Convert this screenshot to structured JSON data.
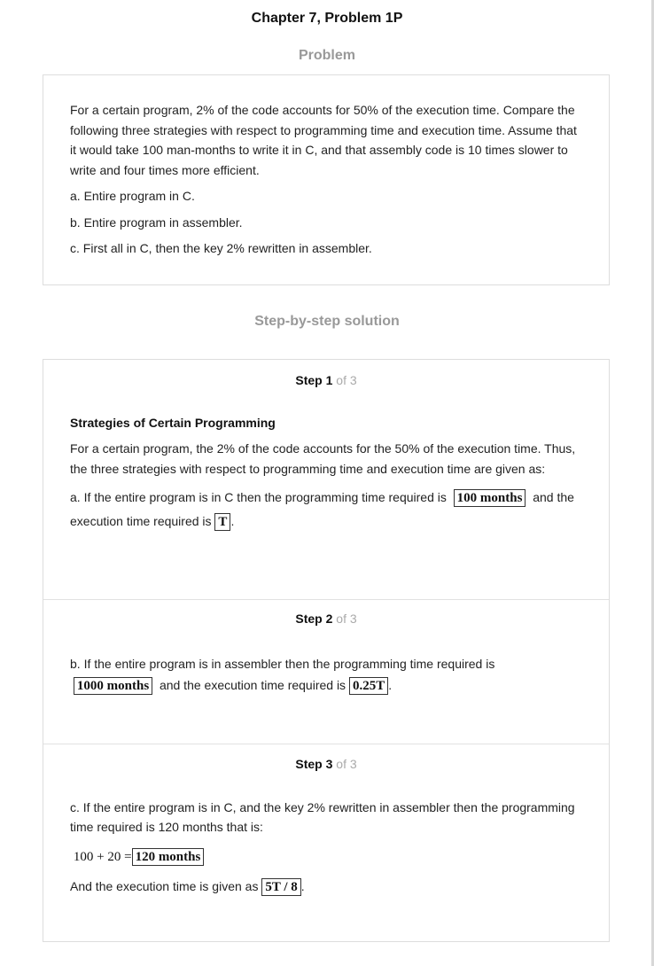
{
  "page": {
    "title": "Chapter 7, Problem 1P",
    "problem_heading": "Problem",
    "solution_heading": "Step-by-step solution"
  },
  "problem": {
    "paragraph": "For a certain program, 2% of the code accounts for 50% of the execution time. Compare the following three strategies with respect to programming time and execution time. Assume that it would take 100 man-months to write it in C, and that assembly code is 10 times slower to write and four times more efficient.",
    "option_a": "a. Entire program in C.",
    "option_b": "b. Entire program in assembler.",
    "option_c": "c. First all in C, then the key 2% rewritten in assembler."
  },
  "steps": [
    {
      "label": "Step",
      "number": "1",
      "of": "of 3",
      "heading": "Strategies of Certain Programming",
      "intro": "For a certain program, the 2% of the code accounts for the 50% of the execution time. Thus, the three strategies with respect to programming time and execution time are given as:",
      "text_before": "a. If the entire program is in C then the programming time required is",
      "box1": "100 months",
      "text_middle": "and the execution time required is",
      "box2": "T",
      "text_after": "."
    },
    {
      "label": "Step",
      "number": "2",
      "of": "of 3",
      "text_before": "b. If the entire program is in assembler then the programming time required is",
      "box1": "1000 months",
      "text_middle": "and the execution time required is",
      "box2": "0.25T",
      "text_after": "."
    },
    {
      "label": "Step",
      "number": "3",
      "of": "of 3",
      "text_before": "c. If the entire program is in C, and the key 2% rewritten in assembler then the programming time required is 120 months that is:",
      "equation_lhs": "100 + 20 =",
      "box1": "120 months",
      "text_middle": "And the execution time is given as",
      "box2": "5T / 8",
      "text_after": "."
    }
  ]
}
